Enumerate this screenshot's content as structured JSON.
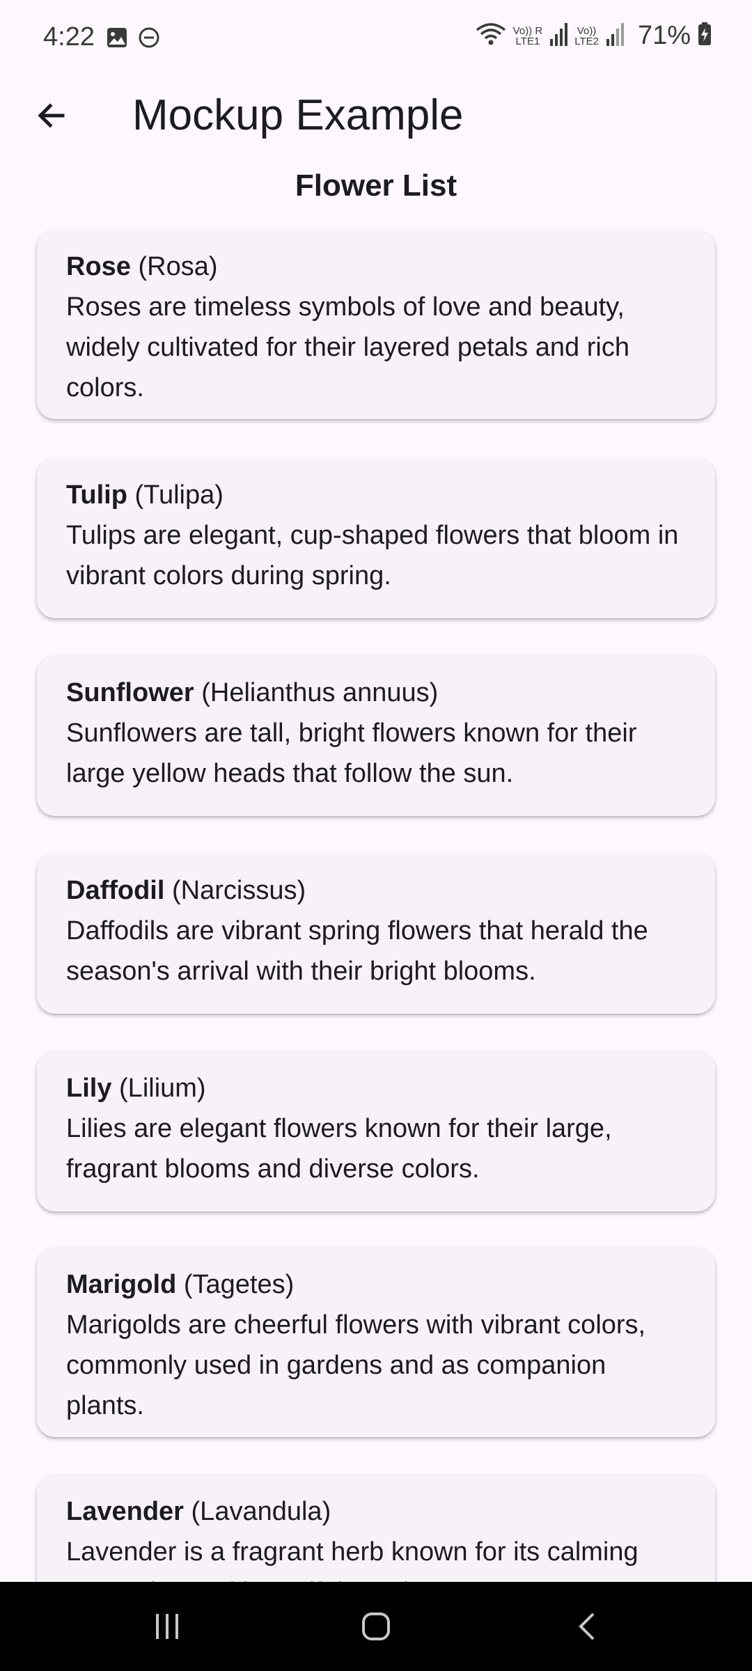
{
  "status_bar": {
    "time": "4:22",
    "icons_left": [
      "image-icon",
      "do-not-disturb-icon"
    ],
    "sim1_label_top": "Vo)) R",
    "sim1_label_bottom": "LTE1",
    "sim2_label_top": "Vo))",
    "sim2_label_bottom": "LTE2",
    "battery": "71%"
  },
  "app_bar": {
    "title": "Mockup Example",
    "back_icon": "arrow-back-icon"
  },
  "heading": "Flower List",
  "flowers": [
    {
      "name": "Rose",
      "scientific": "(Rosa)",
      "description": "Roses are timeless symbols of love and beauty, widely cultivated for their layered petals and rich colors."
    },
    {
      "name": "Tulip",
      "scientific": "(Tulipa)",
      "description": "Tulips are elegant, cup-shaped flowers that bloom in vibrant colors during spring."
    },
    {
      "name": "Sunflower",
      "scientific": "(Helianthus annuus)",
      "description": "Sunflowers are tall, bright flowers known for their large yellow heads that follow the sun."
    },
    {
      "name": "Daffodil",
      "scientific": "(Narcissus)",
      "description": "Daffodils are vibrant spring flowers that herald the season's arrival with their bright blooms."
    },
    {
      "name": "Lily",
      "scientific": "(Lilium)",
      "description": "Lilies are elegant flowers known for their large, fragrant blooms and diverse colors."
    },
    {
      "name": "Marigold",
      "scientific": "(Tagetes)",
      "description": "Marigolds are cheerful flowers with vibrant colors, commonly used in gardens and as companion plants."
    },
    {
      "name": "Lavender",
      "scientific": "(Lavandula)",
      "description": "Lavender is a fragrant herb known for its calming properties and beautiful purple"
    }
  ],
  "nav_bar": {
    "icons": [
      "recent-apps-icon",
      "home-icon",
      "back-icon"
    ]
  },
  "colors": {
    "background": "#fdf7fe",
    "card": "#f7f1f8",
    "text": "#1d1b20",
    "nav_bar": "#000000"
  }
}
